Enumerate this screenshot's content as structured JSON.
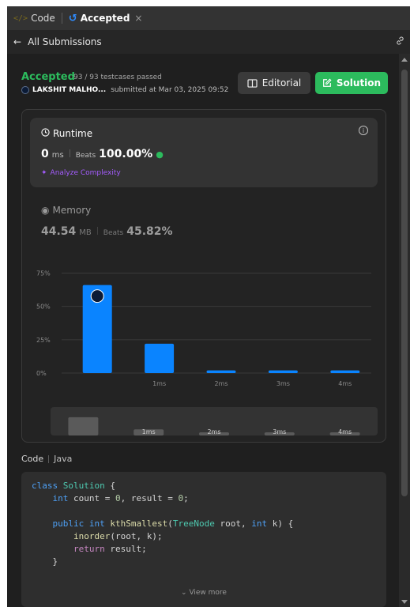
{
  "tabs": [
    {
      "label": "Code",
      "icon": "code-icon",
      "active": false
    },
    {
      "label": "Accepted",
      "icon": "history-icon",
      "active": true,
      "close": "×"
    }
  ],
  "subheader": {
    "back_label": "All Submissions",
    "back_icon": "arrow-left-icon",
    "link_icon": "link-icon"
  },
  "result": {
    "status": "Accepted",
    "testcases": "93 / 93 testcases passed",
    "user": "LAKSHIT MALHO...",
    "submitted": "submitted at Mar 03, 2025 09:52"
  },
  "buttons": {
    "editorial": "Editorial",
    "solution": "Solution"
  },
  "runtime": {
    "title": "Runtime",
    "value": "0",
    "unit": "ms",
    "beats_label": "Beats",
    "beats": "100.00%",
    "analyze": "Analyze Complexity"
  },
  "memory": {
    "title": "Memory",
    "value": "44.54",
    "unit": "MB",
    "beats_label": "Beats",
    "beats": "45.82%"
  },
  "colors": {
    "accent_green": "#2cbb5d",
    "bar_blue": "#0a84ff",
    "purple": "#a55cff"
  },
  "chart_data": {
    "type": "bar",
    "categories": [
      "0ms",
      "1ms",
      "2ms",
      "3ms",
      "4ms"
    ],
    "x_tick_labels": [
      "",
      "1ms",
      "2ms",
      "3ms",
      "4ms"
    ],
    "values": [
      66,
      22,
      2,
      2,
      2
    ],
    "yticks": [
      "75%",
      "50%",
      "25%",
      "0%"
    ],
    "ylim": [
      0,
      80
    ],
    "highlight_index": 0,
    "scrubber_labels": [
      "1ms",
      "2ms",
      "3ms",
      "4ms"
    ]
  },
  "code": {
    "label": "Code",
    "language": "Java",
    "view_more": "View more",
    "lines": [
      "class Solution {",
      "    int count = 0, result = 0;",
      "",
      "    public int kthSmallest(TreeNode root, int k) {",
      "        inorder(root, k);",
      "        return result;",
      "    }"
    ]
  }
}
